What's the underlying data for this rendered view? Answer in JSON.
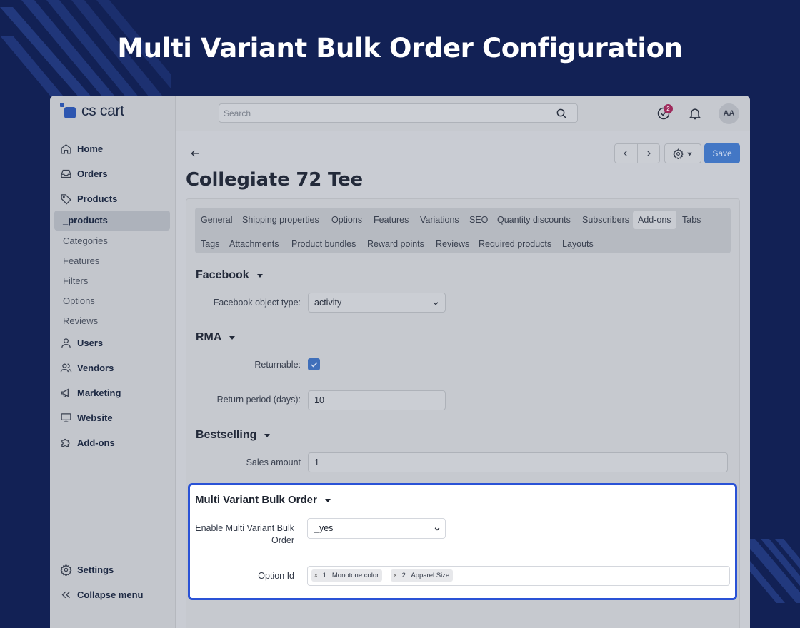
{
  "banner": {
    "title": "Multi Variant Bulk Order Configuration"
  },
  "app": {
    "logo_text": "cs cart",
    "search_placeholder": "Search",
    "notifications_count": "2",
    "avatar_initials": "AA"
  },
  "sidebar": {
    "items": [
      {
        "label": "Home",
        "icon": "home-icon"
      },
      {
        "label": "Orders",
        "icon": "inbox-icon"
      },
      {
        "label": "Products",
        "icon": "tag-icon"
      }
    ],
    "active_sub": "_products",
    "subitems": [
      "Categories",
      "Features",
      "Filters",
      "Options",
      "Reviews"
    ],
    "items_after": [
      {
        "label": "Users",
        "icon": "user-icon"
      },
      {
        "label": "Vendors",
        "icon": "users-icon"
      },
      {
        "label": "Marketing",
        "icon": "megaphone-icon"
      },
      {
        "label": "Website",
        "icon": "monitor-icon"
      },
      {
        "label": "Add-ons",
        "icon": "puzzle-icon"
      }
    ],
    "settings_label": "Settings",
    "collapse_label": "Collapse menu"
  },
  "toolbar": {
    "save_label": "Save"
  },
  "page": {
    "title": "Collegiate 72 Tee"
  },
  "tabs": {
    "row1": [
      "General",
      "Shipping properties",
      "Options",
      "Features",
      "Variations",
      "SEO",
      "Quantity discounts",
      "Subscribers",
      "Add-ons",
      "Tabs"
    ],
    "row2": [
      "Tags",
      "Attachments",
      "Product bundles",
      "Reward points",
      "Reviews",
      "Required products",
      "Layouts"
    ],
    "active": "Add-ons"
  },
  "facebook": {
    "title": "Facebook",
    "object_type_label": "Facebook object type:",
    "object_type_value": "activity"
  },
  "rma": {
    "title": "RMA",
    "returnable_label": "Returnable:",
    "returnable_checked": true,
    "return_period_label": "Return period (days):",
    "return_period_value": "10"
  },
  "bestselling": {
    "title": "Bestselling",
    "sales_amount_label": "Sales amount",
    "sales_amount_value": "1"
  },
  "multi_variant": {
    "title": "Multi Variant Bulk Order",
    "enable_label": "Enable Multi Variant Bulk Order",
    "enable_value": "_yes",
    "option_id_label": "Option Id",
    "options": [
      {
        "remove": "×",
        "label": "1 : Monotone color"
      },
      {
        "remove": "×",
        "label": "2 : Apparel Size"
      }
    ]
  }
}
